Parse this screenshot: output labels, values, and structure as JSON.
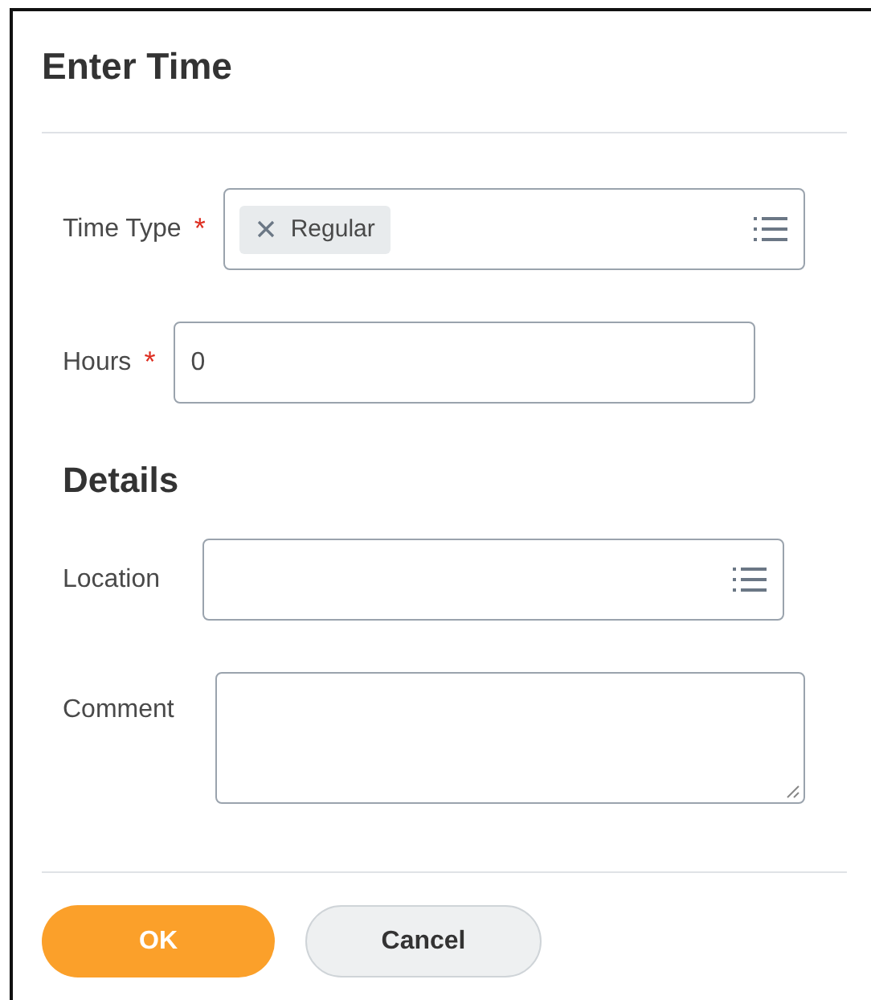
{
  "dialog": {
    "title": "Enter Time"
  },
  "required_marker": "*",
  "fields": [
    {
      "kind": "multiselect",
      "label": "Time Type",
      "required": true,
      "chips": [
        "Regular"
      ]
    },
    {
      "kind": "text",
      "label": "Hours",
      "required": true,
      "value": "0"
    }
  ],
  "details": {
    "heading": "Details",
    "fields": [
      {
        "kind": "multiselect",
        "label": "Location",
        "required": false
      },
      {
        "kind": "textarea",
        "label": "Comment",
        "required": false
      }
    ]
  },
  "buttons": [
    {
      "label": "OK",
      "kind": "primary"
    },
    {
      "label": "Cancel",
      "kind": "secondary"
    }
  ]
}
